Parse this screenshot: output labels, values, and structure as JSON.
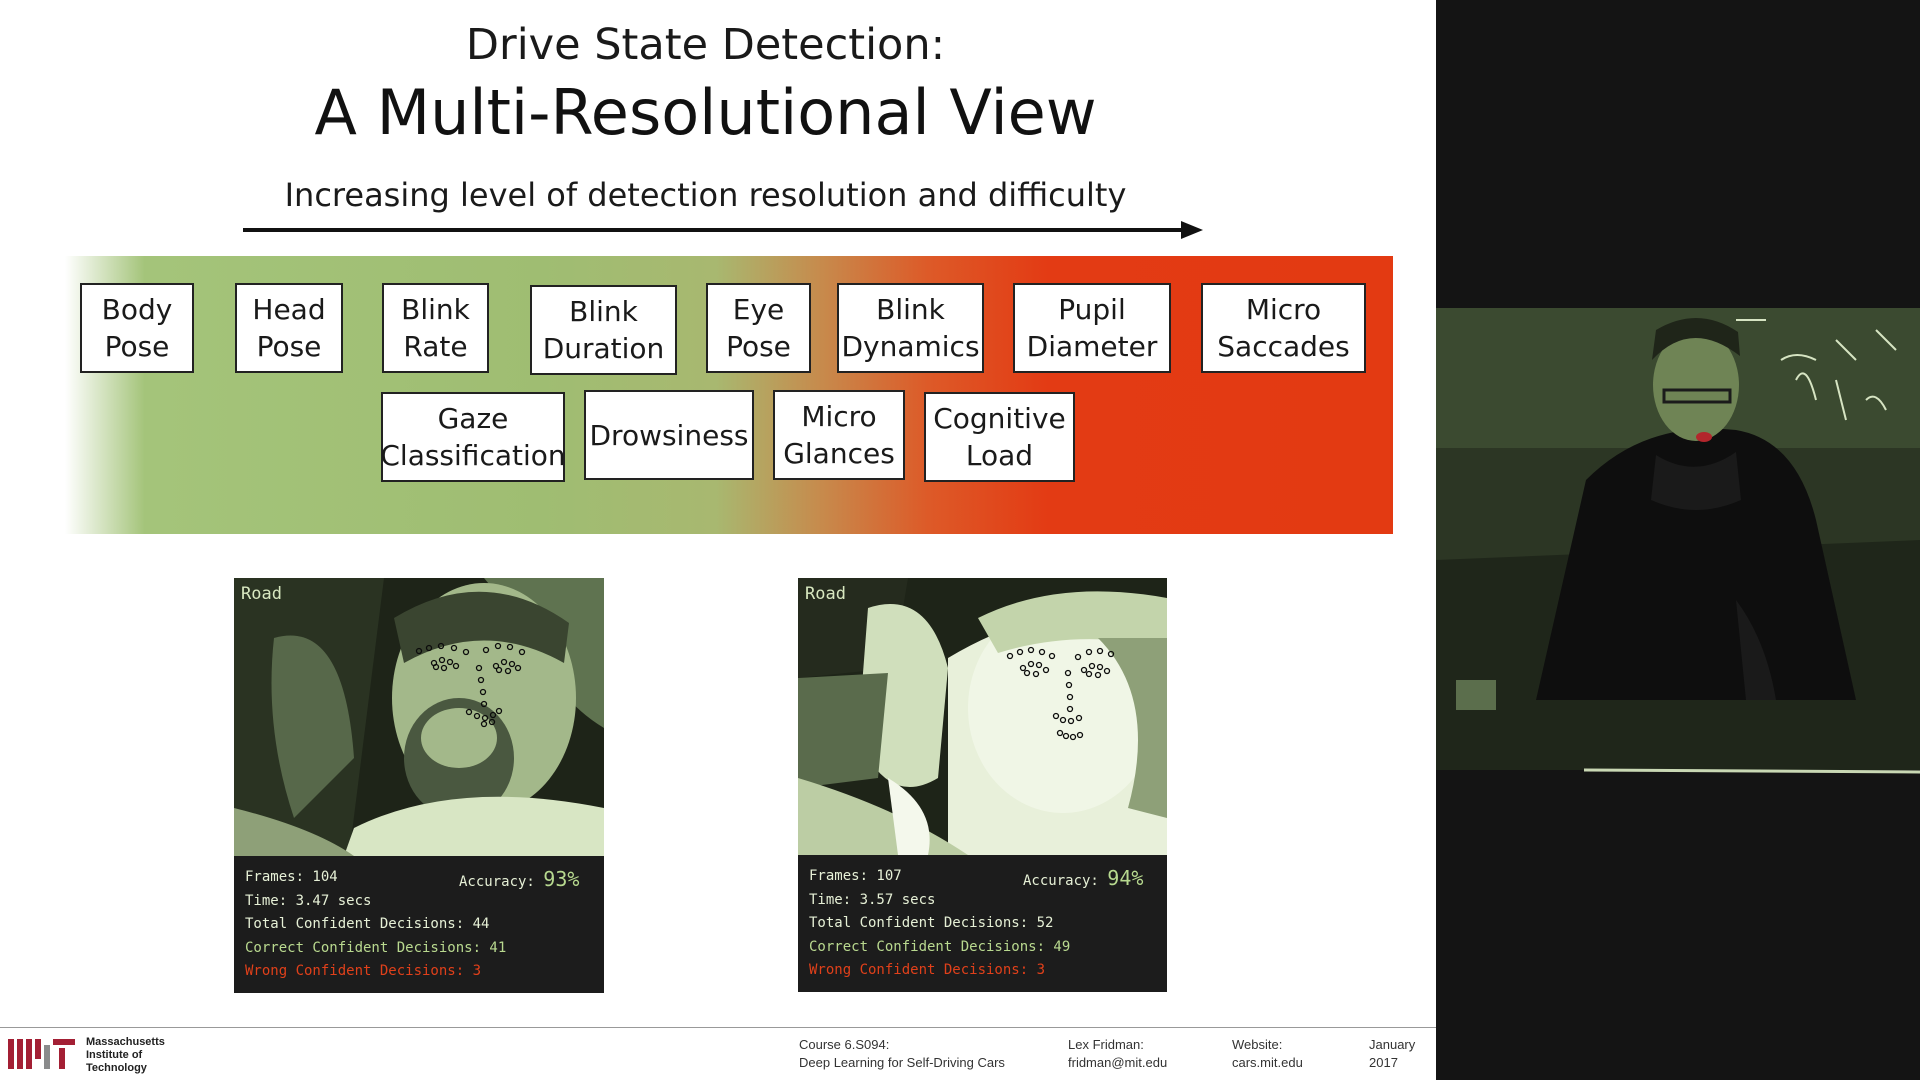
{
  "slide": {
    "title_line1": "Drive State Detection:",
    "title_line2": "A Multi-Resolutional View",
    "subtitle": "Increasing level of detection resolution and difficulty",
    "row1": [
      "Body\nPose",
      "Head\nPose",
      "Blink\nRate",
      "Blink\nDuration",
      "Eye\nPose",
      "Blink\nDynamics",
      "Pupil\nDiameter",
      "Micro\nSaccades"
    ],
    "row2": [
      "Gaze\nClassification",
      "Drowsiness",
      "Micro\nGlances",
      "Cognitive\nLoad"
    ]
  },
  "panels": [
    {
      "road_label": "Road",
      "frames": "Frames: 104",
      "accuracy_label": "Accuracy:",
      "accuracy_value": "93%",
      "time": "Time: 3.47 secs",
      "total": "Total Confident Decisions: 44",
      "correct": "Correct Confident Decisions: 41",
      "wrong": "Wrong Confident Decisions: 3"
    },
    {
      "road_label": "Road",
      "frames": "Frames: 107",
      "accuracy_label": "Accuracy:",
      "accuracy_value": "94%",
      "time": "Time: 3.57 secs",
      "total": "Total Confident Decisions: 52",
      "correct": "Correct Confident Decisions: 49",
      "wrong": "Wrong Confident Decisions: 3"
    }
  ],
  "footer": {
    "institute": [
      "Massachusetts",
      "Institute of",
      "Technology"
    ],
    "course_line1": "Course 6.S094:",
    "course_line2": "Deep Learning for Self-Driving Cars",
    "author_line1": "Lex Fridman:",
    "author_line2": "fridman@mit.edu",
    "website_line1": "Website:",
    "website_line2": "cars.mit.edu",
    "date_line1": "January",
    "date_line2": "2017"
  },
  "colors": {
    "band_green": "#9fbd72",
    "band_red": "#e33a12",
    "correct_text": "#b9d98f",
    "wrong_text": "#e0401a",
    "mit_red": "#a31f34"
  }
}
